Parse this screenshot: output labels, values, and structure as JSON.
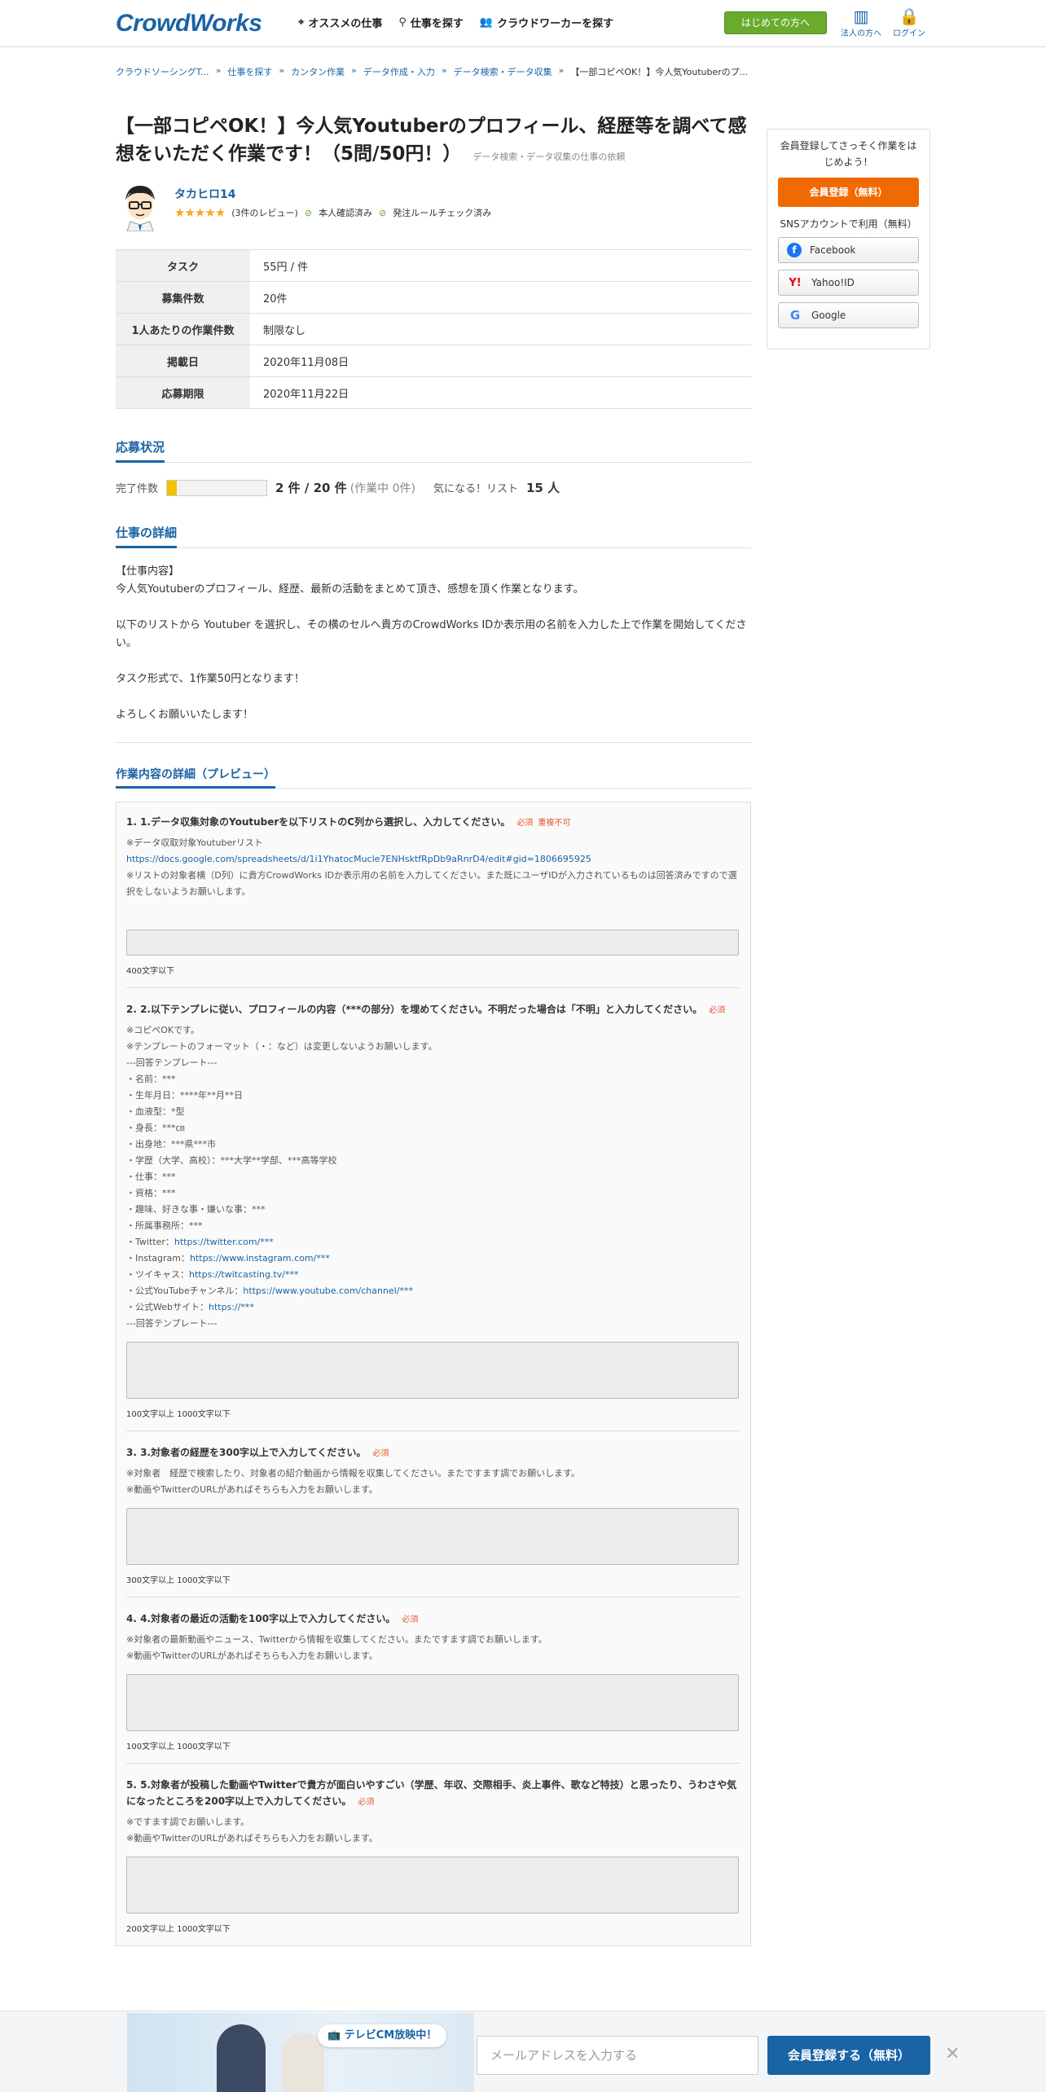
{
  "header": {
    "logo": "CrowdWorks",
    "nav": [
      {
        "icon": "pin-icon",
        "label": "オススメの仕事"
      },
      {
        "icon": "search-icon",
        "label": "仕事を探す"
      },
      {
        "icon": "people-icon",
        "label": "クラウドワーカーを探す"
      }
    ],
    "start_button": "はじめての方へ",
    "corporate_label": "法人の方へ",
    "login_label": "ログイン"
  },
  "breadcrumb": [
    "クラウドソーシングT...",
    "仕事を探す",
    "カンタン作業",
    "データ作成・入力",
    "データ検索・データ収集",
    "【一部コピペOK！】今人気Youtuberのプ..."
  ],
  "job": {
    "title": "【一部コピペOK！】今人気Youtuberのプロフィール、経歴等を調べて感想をいただく作業です！（5問/50円！）",
    "category": "データ検索・データ収集の仕事の依頼",
    "client_name": "タカヒロ14",
    "rating": 5,
    "reviews": "(3件のレビュー)",
    "identity": "本人確認済み",
    "rule_check": "発注ルールチェック済み"
  },
  "info_table": [
    {
      "key": "タスク",
      "value": "55円 / 件"
    },
    {
      "key": "募集件数",
      "value": "20件"
    },
    {
      "key": "1人あたりの作業件数",
      "value": "制限なし"
    },
    {
      "key": "掲載日",
      "value": "2020年11月08日"
    },
    {
      "key": "応募期限",
      "value": "2020年11月22日"
    }
  ],
  "status": {
    "heading": "応募状況",
    "complete_label": "完了件数",
    "progress": 0.1,
    "count": "2 件 / 20 件",
    "in_progress": "(作業中 0件)",
    "fav_label": "気になる！リスト",
    "fav_count": "15 人"
  },
  "detail": {
    "heading": "仕事の詳細",
    "body": "【仕事内容】\n今人気Youtuberのプロフィール、経歴、最新の活動をまとめて頂き、感想を頂く作業となります。\n\n以下のリストから Youtuber を選択し、その横のセルへ貴方のCrowdWorks IDか表示用の名前を入力した上で作業を開始してください。\n\nタスク形式で、1作業50円となります！\n\nよろしくお願いいたします！"
  },
  "preview": {
    "heading": "作業内容の詳細（プレビュー）",
    "questions": [
      {
        "title": "1. 1.データ収集対象のYoutuberを以下リストのC列から選択し、入力してください。",
        "required": "必須",
        "extra": "重複不可",
        "lines": [
          "※データ収取対象Youtuberリスト",
          "https://docs.google.com/spreadsheets/d/1i1YhatocMucle7ENHsktfRpDb9aRnrD4/edit#gid=1806695925",
          "※リストの対象者横（D列）に貴方CrowdWorks IDか表示用の名前を入力してください。また既にユーザIDが入力されているものは回答済みですので選択をしないようお願いします。"
        ],
        "limit": "400文字以下"
      },
      {
        "title": "2. 2.以下テンプレに従い、プロフィールの内容（***の部分）を埋めてください。不明だった場合は「不明」と入力してください。",
        "required": "必須",
        "lines": [
          "※コピペOKです。",
          "※テンプレートのフォーマット（・：など）は変更しないようお願いします。",
          "---回答テンプレート---",
          "・名前：***",
          "・生年月日：****年**月**日",
          "・血液型：*型",
          "・身長：***㎝",
          "・出身地：***県***市",
          "・学歴（大学、高校）：***大学**学部、***高等学校",
          "・仕事：***",
          "・資格：***",
          "・趣味、好きな事・嫌いな事：***",
          "・所属事務所：***",
          "・Twitter：https://twitter.com/***",
          "・Instagram：https://www.instagram.com/***",
          "・ツイキャス：https://twitcasting.tv/***",
          "・公式YouTubeチャンネル：https://www.youtube.com/channel/***",
          "・公式Webサイト：https://***",
          "---回答テンプレート---"
        ],
        "limit": "100文字以上 1000文字以下"
      },
      {
        "title": "3. 3.対象者の経歴を300字以上で入力してください。",
        "required": "必須",
        "lines": [
          "※対象者　経歴で検索したり、対象者の紹介動画から情報を収集してください。またですます調でお願いします。",
          "※動画やTwitterのURLがあればそちらも入力をお願いします。"
        ],
        "limit": "300文字以上 1000文字以下"
      },
      {
        "title": "4. 4.対象者の最近の活動を100字以上で入力してください。",
        "required": "必須",
        "lines": [
          "※対象者の最新動画やニュース、Twitterから情報を収集してください。またですます調でお願いします。",
          "※動画やTwitterのURLがあればそちらも入力をお願いします。"
        ],
        "limit": "100文字以上 1000文字以下"
      },
      {
        "title": "5. 5.対象者が投稿した動画やTwitterで貴方が面白いやすごい（学歴、年収、交際相手、炎上事件、歌など特技）と思ったり、うわさや気になったところを200字以上で入力してください。",
        "required": "必須",
        "lines": [
          "※ですます調でお願いします。",
          "※動画やTwitterのURLがあればそちらも入力をお願いします。"
        ],
        "limit": "200文字以上 1000文字以下"
      }
    ]
  },
  "sidebar": {
    "message": "会員登録してさっそく作業をはじめよう！",
    "register_button": "会員登録（無料）",
    "sns_label": "SNSアカウントで利用（無料）",
    "sns": [
      {
        "icon": "facebook-icon",
        "label": "Facebook"
      },
      {
        "icon": "yahoo-icon",
        "label": "Yahoo!ID"
      },
      {
        "icon": "google-icon",
        "label": "Google"
      }
    ]
  },
  "banner": {
    "tv_badge": "テレビCM放映中！",
    "email_placeholder": "メールアドレスを入力する",
    "register_button": "会員登録する（無料）"
  }
}
